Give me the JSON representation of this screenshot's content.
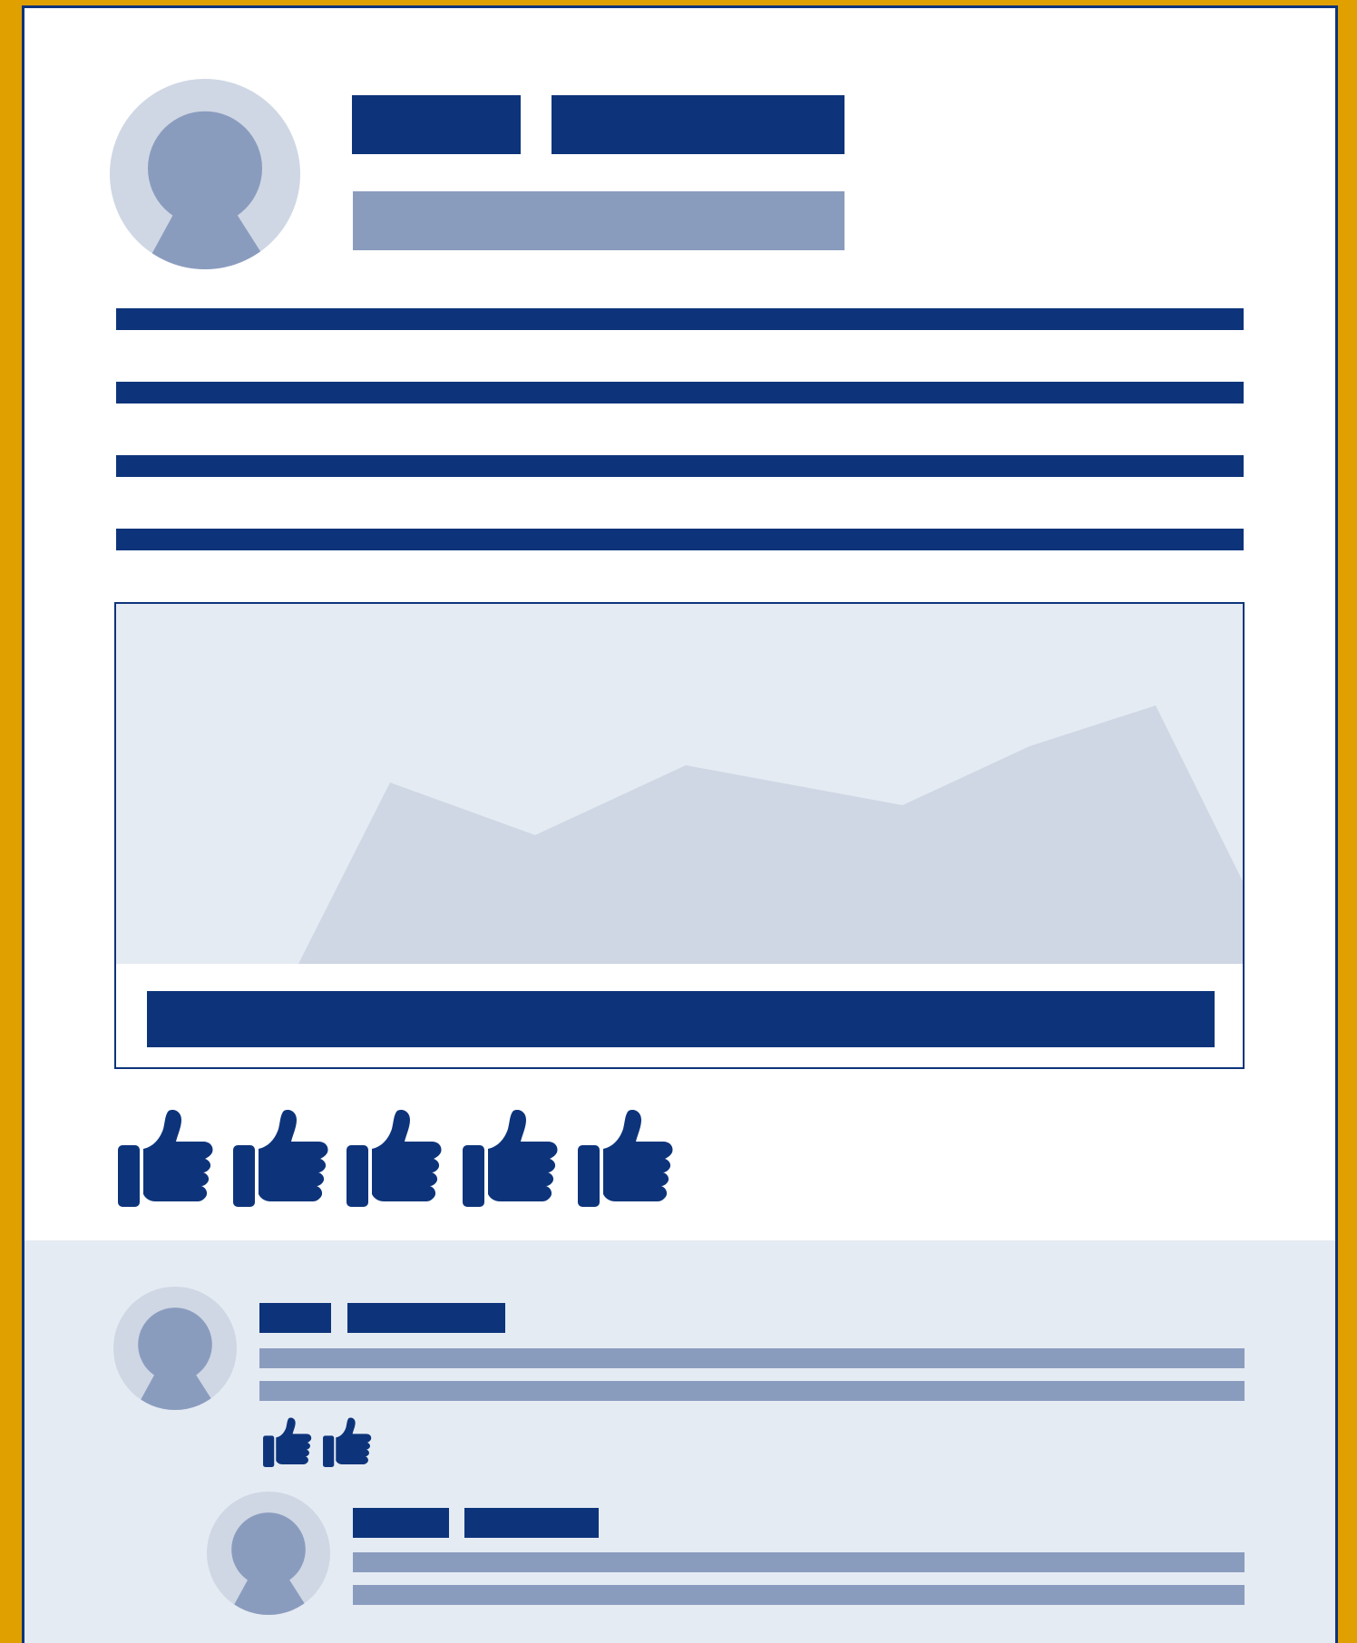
{
  "colors": {
    "frame_border": "#e0a000",
    "accent": "#0d347b",
    "placeholder_mid": "#8a9cbe",
    "placeholder_light": "#cfd7e4",
    "panel_bg": "#e5ebf3",
    "card_bg": "#ffffff"
  },
  "post": {
    "author_avatar_icon": "user-silhouette-icon",
    "image_icon": "area-chart-image-placeholder",
    "reactions": [
      {
        "icon": "thumbs-up-icon"
      },
      {
        "icon": "thumbs-up-icon"
      },
      {
        "icon": "thumbs-up-icon"
      },
      {
        "icon": "thumbs-up-icon"
      },
      {
        "icon": "thumbs-up-icon"
      }
    ]
  },
  "comments": [
    {
      "avatar_icon": "user-silhouette-icon",
      "reactions": [
        {
          "icon": "thumbs-up-icon"
        },
        {
          "icon": "thumbs-up-icon"
        }
      ]
    },
    {
      "avatar_icon": "user-silhouette-icon",
      "reactions": []
    }
  ]
}
